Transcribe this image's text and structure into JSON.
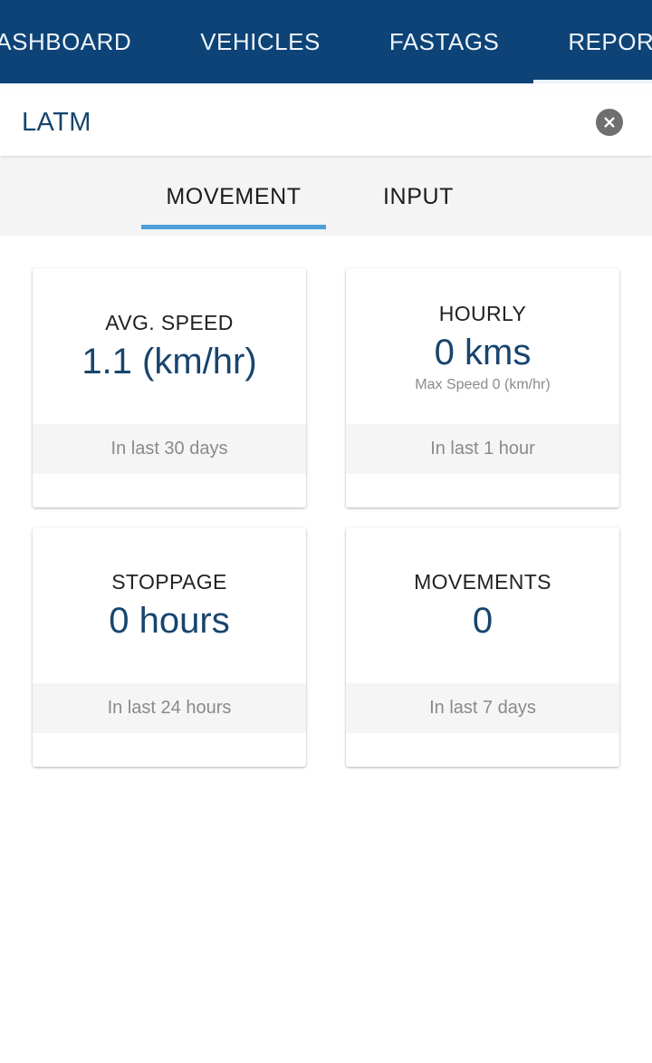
{
  "topnav": {
    "background": "#0d4377",
    "text_color": "#eef4f9",
    "items": [
      {
        "label": "DASHBOARD",
        "active": false
      },
      {
        "label": "VEHICLES",
        "active": false
      },
      {
        "label": "FASTAGS",
        "active": false
      },
      {
        "label": "REPORTS",
        "active": true
      }
    ]
  },
  "header": {
    "title": "LATM",
    "title_color": "#17456e",
    "close_icon": "close-icon",
    "close_button_color": "#6f6f6f"
  },
  "subtabs": {
    "indicator_color": "#4b9fd5",
    "background": "#f4f4f4",
    "items": [
      {
        "label": "MOVEMENT",
        "active": true
      },
      {
        "label": "INPUT",
        "active": false
      }
    ]
  },
  "cards": [
    {
      "title": "AVG. SPEED",
      "value": "1.1 (km/hr)",
      "subtitle": "",
      "footer": "In last 30 days"
    },
    {
      "title": "HOURLY",
      "value": "0 kms",
      "subtitle": "Max Speed 0 (km/hr)",
      "footer": "In last 1 hour"
    },
    {
      "title": "STOPPAGE",
      "value": "0 hours",
      "subtitle": "",
      "footer": "In last 24 hours"
    },
    {
      "title": "MOVEMENTS",
      "value": "0",
      "subtitle": "",
      "footer": "In last 7 days"
    }
  ],
  "theme": {
    "accent_blue": "#4b9fd5",
    "value_blue": "#17456e",
    "navy": "#0d4377",
    "footer_grey": "#f5f5f5",
    "muted_text": "#8a8a8a"
  }
}
